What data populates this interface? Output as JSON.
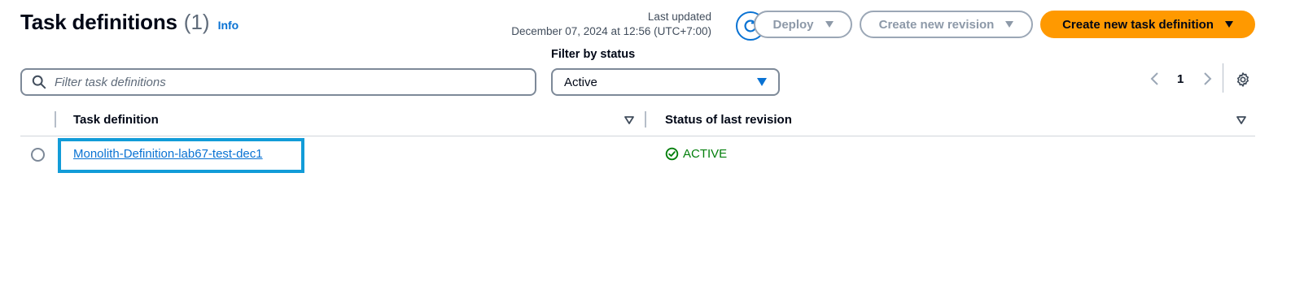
{
  "header": {
    "title": "Task definitions",
    "count": "(1)",
    "info_label": "Info",
    "last_updated_label": "Last updated",
    "last_updated_value": "December 07, 2024 at 12:56 (UTC+7:00)"
  },
  "actions": {
    "deploy_label": "Deploy",
    "create_revision_label": "Create new revision",
    "create_task_label": "Create new task definition"
  },
  "filters": {
    "search_placeholder": "Filter task definitions",
    "status_label": "Filter by status",
    "status_value": "Active"
  },
  "pagination": {
    "current_page": "1"
  },
  "table": {
    "columns": [
      "Task definition",
      "Status of last revision"
    ],
    "rows": [
      {
        "task_definition": "Monolith-Definition-lab67-test-dec1",
        "status": "ACTIVE"
      }
    ]
  },
  "icons": {
    "refresh": "refresh-icon",
    "search": "search-icon",
    "settings": "gear-icon",
    "status": "check-circle-icon"
  },
  "colors": {
    "primary": "#ff9900",
    "link": "#0972d3",
    "success": "#037f0c",
    "highlight": "#129cd8"
  }
}
